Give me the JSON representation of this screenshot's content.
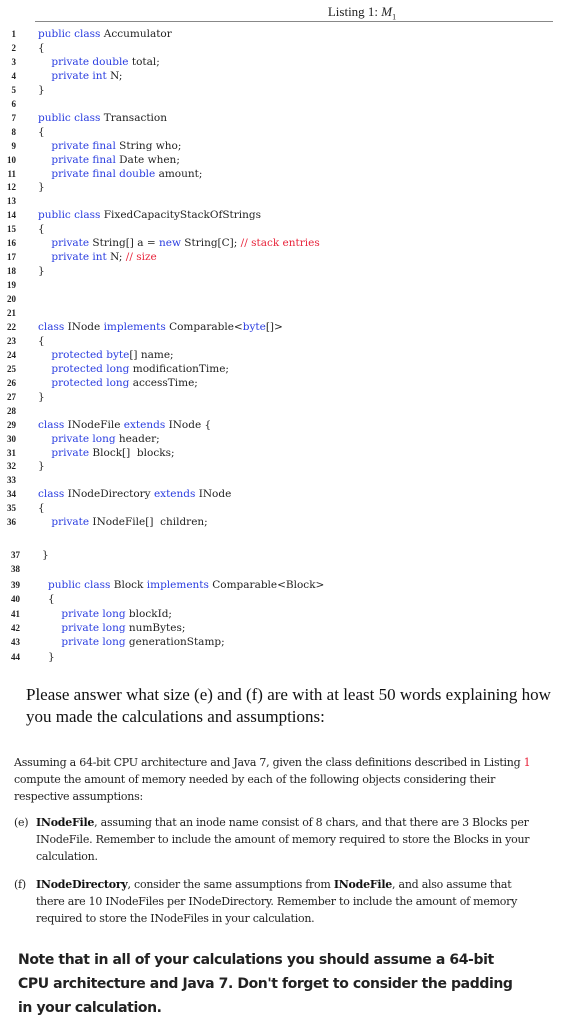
{
  "listing": {
    "caption_prefix": "Listing 1: ",
    "caption_symbol": "M",
    "caption_subscript": "1"
  },
  "code_lines": [
    {
      "n": "1",
      "tokens": [
        {
          "t": "public class ",
          "c": "kw"
        },
        {
          "t": "Accumulator",
          "c": ""
        }
      ]
    },
    {
      "n": "2",
      "tokens": [
        {
          "t": "{",
          "c": ""
        }
      ]
    },
    {
      "n": "3",
      "tokens": [
        {
          "t": "    private double ",
          "c": "kw"
        },
        {
          "t": "total;",
          "c": ""
        }
      ]
    },
    {
      "n": "4",
      "tokens": [
        {
          "t": "    private int ",
          "c": "kw"
        },
        {
          "t": "N;",
          "c": ""
        }
      ]
    },
    {
      "n": "5",
      "tokens": [
        {
          "t": "}",
          "c": ""
        }
      ]
    },
    {
      "n": "6",
      "tokens": []
    },
    {
      "n": "7",
      "tokens": [
        {
          "t": "public class ",
          "c": "kw"
        },
        {
          "t": "Transaction",
          "c": ""
        }
      ]
    },
    {
      "n": "8",
      "tokens": [
        {
          "t": "{",
          "c": ""
        }
      ]
    },
    {
      "n": "9",
      "tokens": [
        {
          "t": "    private final ",
          "c": "kw"
        },
        {
          "t": "String who;",
          "c": ""
        }
      ]
    },
    {
      "n": "10",
      "tokens": [
        {
          "t": "    private final ",
          "c": "kw"
        },
        {
          "t": "Date when;",
          "c": ""
        }
      ]
    },
    {
      "n": "11",
      "tokens": [
        {
          "t": "    private final double ",
          "c": "kw"
        },
        {
          "t": "amount;",
          "c": ""
        }
      ]
    },
    {
      "n": "12",
      "tokens": [
        {
          "t": "}",
          "c": ""
        }
      ]
    },
    {
      "n": "13",
      "tokens": []
    },
    {
      "n": "14",
      "tokens": [
        {
          "t": "public class ",
          "c": "kw"
        },
        {
          "t": "FixedCapacityStackOfStrings",
          "c": ""
        }
      ]
    },
    {
      "n": "15",
      "tokens": [
        {
          "t": "{",
          "c": ""
        }
      ]
    },
    {
      "n": "16",
      "tokens": [
        {
          "t": "    private ",
          "c": "kw"
        },
        {
          "t": "String[] a = ",
          "c": ""
        },
        {
          "t": "new ",
          "c": "kw"
        },
        {
          "t": "String[C]; ",
          "c": ""
        },
        {
          "t": "// stack entries",
          "c": "cm"
        }
      ]
    },
    {
      "n": "17",
      "tokens": [
        {
          "t": "    private int ",
          "c": "kw"
        },
        {
          "t": "N; ",
          "c": ""
        },
        {
          "t": "// size",
          "c": "cm"
        }
      ]
    },
    {
      "n": "18",
      "tokens": [
        {
          "t": "}",
          "c": ""
        }
      ]
    },
    {
      "n": "19",
      "tokens": []
    },
    {
      "n": "20",
      "tokens": []
    },
    {
      "n": "21",
      "tokens": []
    },
    {
      "n": "22",
      "tokens": [
        {
          "t": "class ",
          "c": "kw"
        },
        {
          "t": "INode ",
          "c": ""
        },
        {
          "t": "implements ",
          "c": "kw"
        },
        {
          "t": "Comparable<",
          "c": ""
        },
        {
          "t": "byte",
          "c": "kw"
        },
        {
          "t": "[]>",
          "c": ""
        }
      ]
    },
    {
      "n": "23",
      "tokens": [
        {
          "t": "{",
          "c": ""
        }
      ]
    },
    {
      "n": "24",
      "tokens": [
        {
          "t": "    protected byte",
          "c": "kw"
        },
        {
          "t": "[] name;",
          "c": ""
        }
      ]
    },
    {
      "n": "25",
      "tokens": [
        {
          "t": "    protected long ",
          "c": "kw"
        },
        {
          "t": "modificationTime;",
          "c": ""
        }
      ]
    },
    {
      "n": "26",
      "tokens": [
        {
          "t": "    protected long ",
          "c": "kw"
        },
        {
          "t": "accessTime;",
          "c": ""
        }
      ]
    },
    {
      "n": "27",
      "tokens": [
        {
          "t": "}",
          "c": ""
        }
      ]
    },
    {
      "n": "28",
      "tokens": []
    },
    {
      "n": "29",
      "tokens": [
        {
          "t": "class ",
          "c": "kw"
        },
        {
          "t": "INodeFile ",
          "c": ""
        },
        {
          "t": "extends ",
          "c": "kw"
        },
        {
          "t": "INode {",
          "c": ""
        }
      ]
    },
    {
      "n": "30",
      "tokens": [
        {
          "t": "    private long ",
          "c": "kw"
        },
        {
          "t": "header;",
          "c": ""
        }
      ]
    },
    {
      "n": "31",
      "tokens": [
        {
          "t": "    private ",
          "c": "kw"
        },
        {
          "t": "Block[]  blocks;",
          "c": ""
        }
      ]
    },
    {
      "n": "32",
      "tokens": [
        {
          "t": "}",
          "c": ""
        }
      ]
    },
    {
      "n": "33",
      "tokens": []
    },
    {
      "n": "34",
      "tokens": [
        {
          "t": "class ",
          "c": "kw"
        },
        {
          "t": "INodeDirectory ",
          "c": ""
        },
        {
          "t": "extends ",
          "c": "kw"
        },
        {
          "t": "INode",
          "c": ""
        }
      ]
    },
    {
      "n": "35",
      "tokens": [
        {
          "t": "{",
          "c": ""
        }
      ]
    },
    {
      "n": "36",
      "tokens": [
        {
          "t": "    private ",
          "c": "kw"
        },
        {
          "t": "INodeFile[]  children;",
          "c": ""
        }
      ]
    },
    {
      "n": "37",
      "tokens": [
        {
          "t": "}",
          "c": ""
        }
      ]
    },
    {
      "n": "38",
      "tokens": []
    },
    {
      "n": "39",
      "tokens": [
        {
          "t": "public class ",
          "c": "kw"
        },
        {
          "t": "Block ",
          "c": ""
        },
        {
          "t": "implements ",
          "c": "kw"
        },
        {
          "t": "Comparable<Block>",
          "c": ""
        }
      ]
    },
    {
      "n": "40",
      "tokens": [
        {
          "t": "{",
          "c": ""
        }
      ]
    },
    {
      "n": "41",
      "tokens": [
        {
          "t": "    private long ",
          "c": "kw"
        },
        {
          "t": "blockId;",
          "c": ""
        }
      ]
    },
    {
      "n": "42",
      "tokens": [
        {
          "t": "    private long ",
          "c": "kw"
        },
        {
          "t": "numBytes;",
          "c": ""
        }
      ]
    },
    {
      "n": "43",
      "tokens": [
        {
          "t": "    private long ",
          "c": "kw"
        },
        {
          "t": "generationStamp;",
          "c": ""
        }
      ]
    },
    {
      "n": "44",
      "tokens": [
        {
          "t": "}",
          "c": ""
        }
      ]
    }
  ],
  "colors": {
    "keyword": "#2a3de0",
    "comment": "#e8243b",
    "reference": "#e8243b"
  },
  "prompt": "Please answer what size (e) and (f) are with at least 50 words explaining how you made the calculations and assumptions:",
  "intro": {
    "before_ref": "Assuming a 64-bit CPU architecture and Java 7, given the class definitions described in Listing ",
    "ref": "1",
    "after_ref": " compute the amount of memory needed by each of the following objects considering their respective assumptions:"
  },
  "items": [
    {
      "marker": "(e)",
      "bold1": "INodeFile",
      "text1": ", assuming that an inode name consist of 8 chars, and that there are 3 Blocks per INodeFile. Remember to include the amount of memory required to store the Blocks in your calculation.",
      "bold2": "",
      "text2": ""
    },
    {
      "marker": "(f)",
      "bold1": "INodeDirectory",
      "text1": ", consider the same assumptions from ",
      "bold2": "INodeFile",
      "text2": ", and also assume that there are 10 INodeFiles per INodeDirectory. Remember to include the amount of memory required to store the INodeFiles in your calculation."
    }
  ],
  "note": "Note that in all of your calculations you should assume a 64-bit CPU architecture and Java 7. Don't forget to consider the padding in your calculation."
}
